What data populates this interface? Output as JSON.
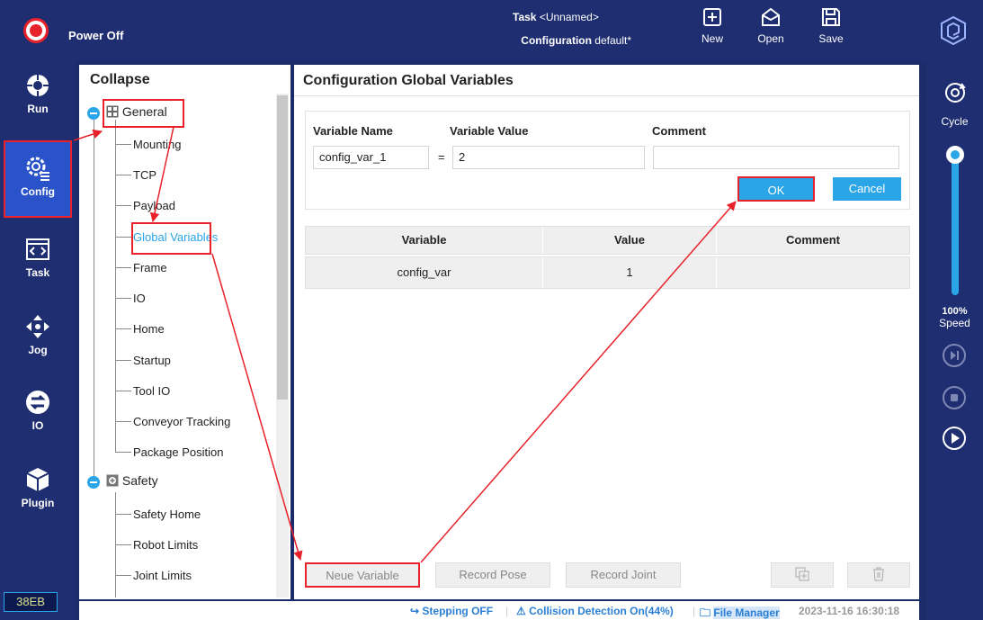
{
  "topbar": {
    "power_label": "Power Off",
    "task_label": "Task",
    "task_value": "<Unnamed>",
    "config_label": "Configuration",
    "config_value": "default*",
    "new_label": "New",
    "open_label": "Open",
    "save_label": "Save"
  },
  "leftnav": {
    "items": [
      {
        "label": "Run",
        "icon": "run-icon"
      },
      {
        "label": "Config",
        "icon": "config-icon"
      },
      {
        "label": "Task",
        "icon": "task-icon"
      },
      {
        "label": "Jog",
        "icon": "jog-icon"
      },
      {
        "label": "IO",
        "icon": "io-icon"
      },
      {
        "label": "Plugin",
        "icon": "plugin-icon"
      }
    ],
    "device_tag": "38EB"
  },
  "tree": {
    "title": "Collapse",
    "general": {
      "label": "General",
      "children": [
        "Mounting",
        "TCP",
        "Payload",
        "Global Variables",
        "Frame",
        "IO",
        "Home",
        "Startup",
        "Tool IO",
        "Conveyor Tracking",
        "Package Position"
      ]
    },
    "safety": {
      "label": "Safety",
      "children": [
        "Safety Home",
        "Robot Limits",
        "Joint Limits"
      ]
    }
  },
  "main": {
    "title": "Configuration Global Variables",
    "form": {
      "name_header": "Variable Name",
      "value_header": "Variable Value",
      "comment_header": "Comment",
      "name_value": "config_var_1",
      "equals": "=",
      "value_value": "2",
      "comment_value": "",
      "ok_label": "OK",
      "cancel_label": "Cancel"
    },
    "table": {
      "headers": [
        "Variable",
        "Value",
        "Comment"
      ],
      "rows": [
        [
          "config_var",
          "1",
          ""
        ]
      ]
    },
    "buttons": {
      "neue": "Neue Variable",
      "record_pose": "Record Pose",
      "record_joint": "Record Joint"
    }
  },
  "statusbar": {
    "stepping": "Stepping OFF",
    "collision": "Collision Detection On(44%)",
    "file_manager": "File Manager",
    "timestamp": "2023-11-16 16:30:18"
  },
  "rightbar": {
    "cycle_label": "Cycle",
    "speed_value": "100%",
    "speed_label": "Speed",
    "speed_fraction": 1.0
  },
  "colors": {
    "accent": "#2aa5e8",
    "navbar": "#1f2e70",
    "highlight": "#e8212a"
  }
}
